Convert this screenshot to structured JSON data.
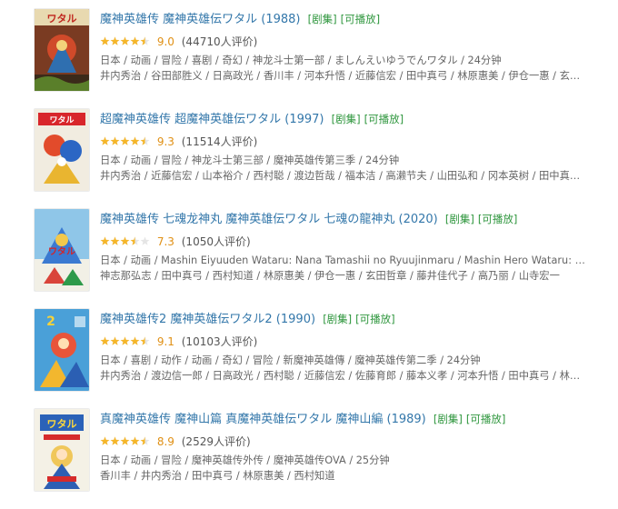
{
  "accent": {
    "link": "#3377aa",
    "tag": "#2e963d",
    "score": "#e09015",
    "star": "#f5b62a"
  },
  "results": [
    {
      "title": "魔神英雄传 魔神英雄伝ワタル (1988)",
      "tag_series": "[剧集]",
      "tag_playable": "[可播放]",
      "rating": 9.0,
      "score_text": "9.0",
      "votes_text": "(44710人评价)",
      "stars_filled": 4.5,
      "meta": "日本 / 动画 / 冒险 / 喜剧 / 奇幻 / 神龙斗士第一部 / ましんえいゆうでんワタル / 24分钟",
      "cast": "井内秀治 / 谷田部胜义 / 日高政光 / 香川丰 / 河本升悟 / 近藤信宏 / 田中真弓 / 林原惠美 / 伊仓一惠 / 玄田哲章 / ..."
    },
    {
      "title": "超魔神英雄传 超魔神英雄伝ワタル (1997)",
      "tag_series": "[剧集]",
      "tag_playable": "[可播放]",
      "rating": 9.3,
      "score_text": "9.3",
      "votes_text": "(11514人评价)",
      "stars_filled": 4.5,
      "meta": "日本 / 动画 / 冒险 / 神龙斗士第三部 / 魔神英雄传第三季 / 24分钟",
      "cast": "井内秀治 / 近藤信宏 / 山本裕介 / 西村聪 / 渡边哲哉 / 福本洁 / 高濑节夫 / 山田弘和 / 冈本英树 / 田中真弓 / 林原..."
    },
    {
      "title": "魔神英雄传 七魂龙神丸 魔神英雄伝ワタル 七魂の龍神丸 (2020)",
      "tag_series": "[剧集]",
      "tag_playable": "[可播放]",
      "rating": 7.3,
      "score_text": "7.3",
      "votes_text": "(1050人评价)",
      "stars_filled": 3.5,
      "meta": "日本 / 动画 / Mashin Eiyuuden Wataru: Nana Tamashii no Ryuujinmaru / Mashin Hero Wataru: The Seven Spi...",
      "cast": "神志那弘志 / 田中真弓 / 西村知道 / 林原惠美 / 伊仓一惠 / 玄田哲章 / 藤井佳代子 / 高乃丽 / 山寺宏一"
    },
    {
      "title": "魔神英雄传2 魔神英雄伝ワタル2 (1990)",
      "tag_series": "[剧集]",
      "tag_playable": "[可播放]",
      "rating": 9.1,
      "score_text": "9.1",
      "votes_text": "(10103人评价)",
      "stars_filled": 4.5,
      "meta": "日本 / 喜剧 / 动作 / 动画 / 奇幻 / 冒险 / 新魔神英雄傳 / 魔神英雄传第二季 / 24分钟",
      "cast": "井内秀治 / 渡边信一郎 / 日高政光 / 西村聪 / 近藤信宏 / 佐藤育郎 / 藤本义孝 / 河本升悟 / 田中真弓 / 林原惠美 / ..."
    },
    {
      "title": "真魔神英雄传 魔神山篇 真魔神英雄伝ワタル 魔神山編 (1989)",
      "tag_series": "[剧集]",
      "tag_playable": "[可播放]",
      "rating": 8.9,
      "score_text": "8.9",
      "votes_text": "(2529人评价)",
      "stars_filled": 4.5,
      "meta": "日本 / 动画 / 冒险 / 魔神英雄传外传 / 魔神英雄传OVA / 25分钟",
      "cast": "香川丰 / 井内秀治 / 田中真弓 / 林原惠美 / 西村知道"
    }
  ]
}
